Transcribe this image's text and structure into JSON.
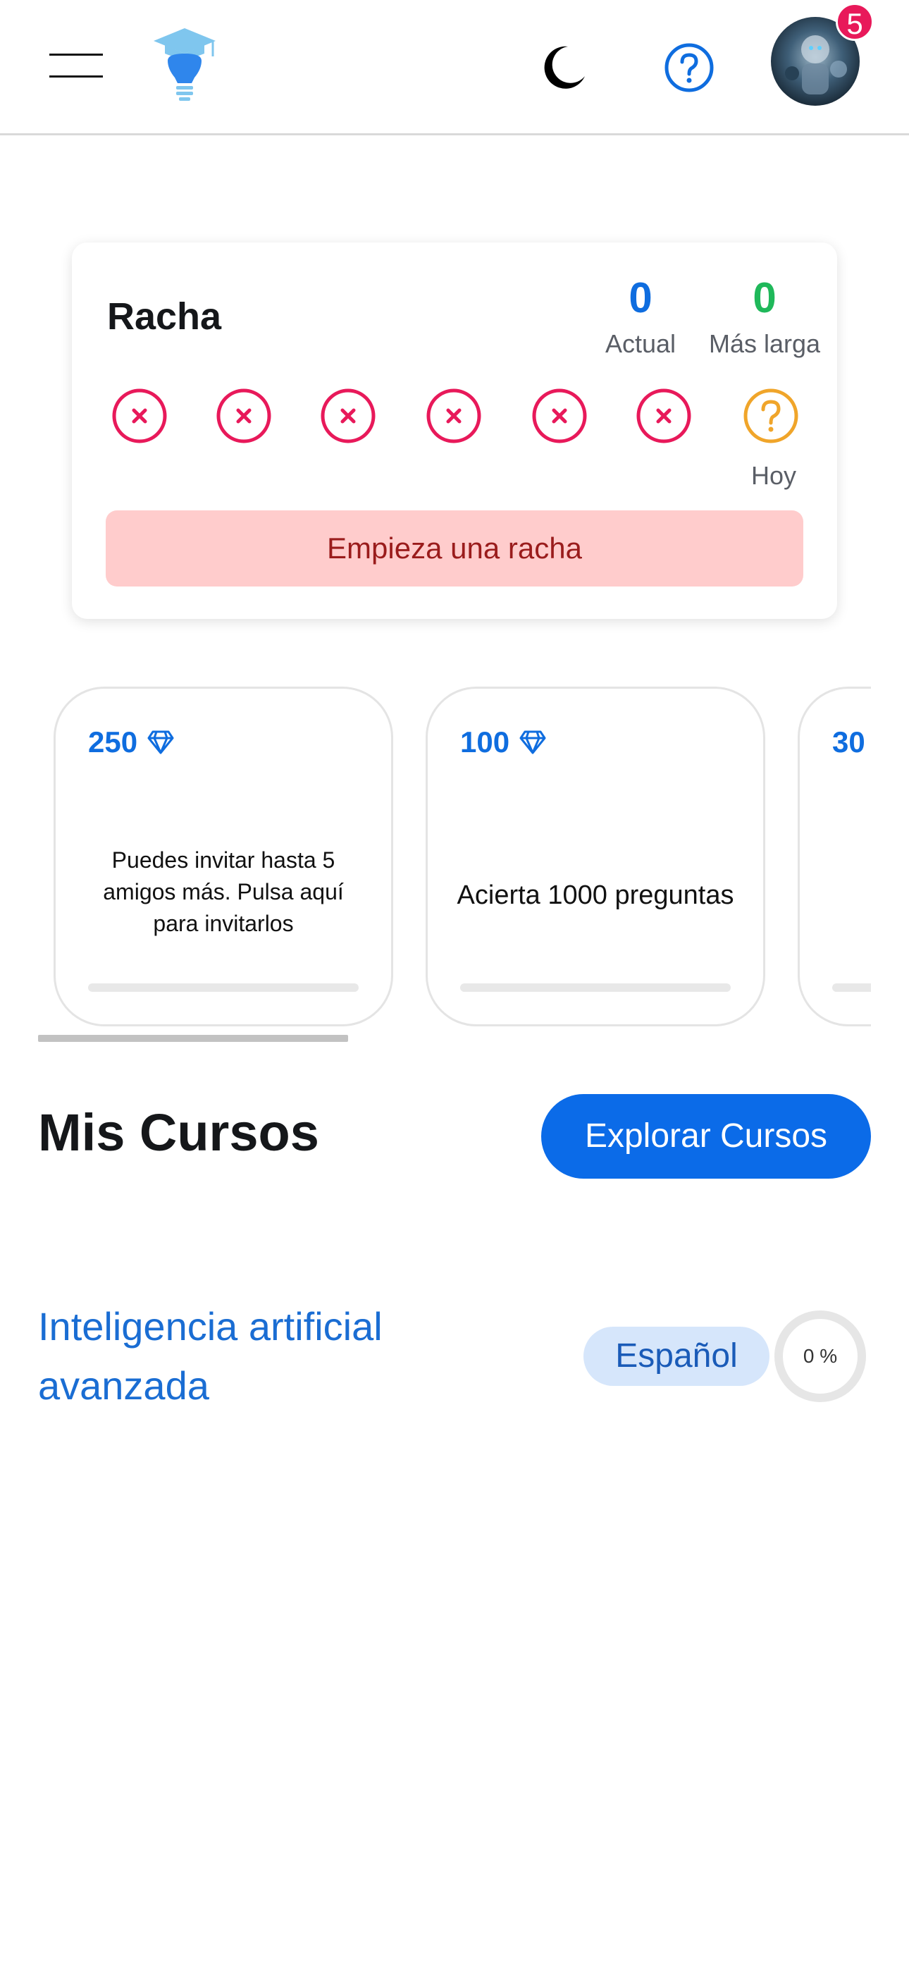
{
  "header": {
    "notification_count": "5",
    "icons": [
      "menu-icon",
      "logo-bulb-graduation-icon",
      "moon-icon",
      "help-icon",
      "avatar"
    ]
  },
  "streak": {
    "title": "Racha",
    "current_value": "0",
    "current_label": "Actual",
    "longest_value": "0",
    "longest_label": "Más larga",
    "days": [
      "missed",
      "missed",
      "missed",
      "missed",
      "missed",
      "missed",
      "today"
    ],
    "today_label": "Hoy",
    "start_button": "Empieza una racha",
    "colors": {
      "missed": "#e8195a",
      "today": "#f0a52a",
      "current": "#0f6ddf",
      "longest": "#1fb85a"
    }
  },
  "achievements": [
    {
      "points": "250",
      "text": "Puedes invitar hasta 5 amigos más. Pulsa aquí para invitarlos",
      "progress": 0
    },
    {
      "points": "100",
      "text": "Acierta 1000 preguntas",
      "progress": 0
    },
    {
      "points": "30",
      "text": "",
      "progress": 0
    }
  ],
  "courses": {
    "title": "Mis Cursos",
    "explore_button": "Explorar Cursos",
    "items": [
      {
        "name": "Inteligencia artificial avanzada",
        "language": "Español",
        "progress_label": "0 %",
        "progress": 0
      }
    ]
  },
  "colors": {
    "accent": "#0b6be8",
    "link": "#1a6dd3"
  }
}
